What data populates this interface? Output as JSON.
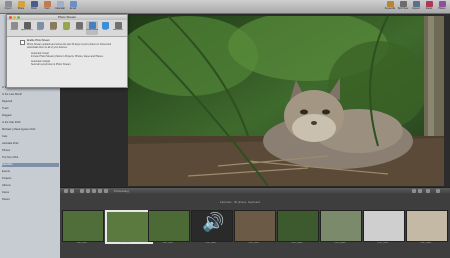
{
  "toolbar": {
    "left_items": [
      {
        "label": "Import",
        "icon": "import-icon",
        "color": "#8a8f99"
      },
      {
        "label": "Share",
        "icon": "share-icon",
        "color": "#d9a13a"
      },
      {
        "label": "Book",
        "icon": "book-icon",
        "color": "#4a5b8c"
      },
      {
        "label": "Card",
        "icon": "card-icon",
        "color": "#c47a4b"
      },
      {
        "label": "Calendar",
        "icon": "calendar-icon",
        "color": "#9fb0c7"
      },
      {
        "label": "Email",
        "icon": "email-icon",
        "color": "#6a8fc9"
      }
    ],
    "right_items": [
      {
        "label": "Keywords",
        "icon": "keywords-icon",
        "color": "#b7862f"
      },
      {
        "label": "Split View",
        "icon": "split-view-icon",
        "color": "#6c6c6c"
      },
      {
        "label": "Inspect",
        "icon": "inspect-icon",
        "color": "#5c6f8f"
      },
      {
        "label": "Faces",
        "icon": "faces-icon",
        "color": "#b3365a"
      },
      {
        "label": "Places",
        "icon": "places-icon",
        "color": "#8f4ea0"
      }
    ]
  },
  "sidebar": {
    "items": [
      {
        "label": "In the Last Week",
        "selected": false
      },
      {
        "label": "In the Last Month",
        "selected": false
      },
      {
        "label": "Rejected",
        "selected": false
      },
      {
        "label": "Trash",
        "selected": false
      },
      {
        "label": "Flagged",
        "selected": false
      },
      {
        "label": "In the Oak 2012",
        "selected": false
      },
      {
        "label": "Michael y Maria Agosto 2012",
        "selected": false
      },
      {
        "label": "Cats",
        "selected": false
      },
      {
        "label": "Australia 2012",
        "selected": false
      },
      {
        "label": "Photos",
        "selected": false
      },
      {
        "label": "Trip Nov 2012",
        "selected": false
      },
      {
        "label": "Favorites",
        "selected": true
      },
      {
        "label": "Events",
        "selected": false
      },
      {
        "label": "Projects",
        "selected": false
      },
      {
        "label": "Albums",
        "selected": false
      },
      {
        "label": "Faces",
        "selected": false
      },
      {
        "label": "Places",
        "selected": false
      }
    ]
  },
  "prefs": {
    "title": "Photo Stream",
    "tabs": [
      {
        "label": "General",
        "icon": "general-icon",
        "color": "#8c8c8c"
      },
      {
        "label": "Appearance",
        "icon": "appearance-icon",
        "color": "#5e5e5e"
      },
      {
        "label": "Import",
        "icon": "import-icon",
        "color": "#7d8fa6"
      },
      {
        "label": "Export",
        "icon": "export-icon",
        "color": "#8a7a5c"
      },
      {
        "label": "Labels",
        "icon": "labels-icon",
        "color": "#9aa64f"
      },
      {
        "label": "Previews",
        "icon": "previews-icon",
        "color": "#6f6f6f"
      },
      {
        "label": "Photo Stream",
        "icon": "photo-stream-icon",
        "color": "#4a7fbf",
        "selected": true
      },
      {
        "label": "Web",
        "icon": "web-icon",
        "color": "#3b8fd9"
      },
      {
        "label": "Advanced",
        "icon": "advanced-icon",
        "color": "#707070"
      }
    ],
    "enable_label": "Enable Photo Stream",
    "description": "Photo Stream uploads and stores the last 30 days of your photos on iCloud and downloads them to all of your devices.",
    "auto_import_label": "Automatic Import",
    "auto_import_desc": "Include Photo Stream photos in Projects, Photos, Faces and Places.",
    "auto_upload_label": "Automatic Upload",
    "auto_upload_desc": "Send all new photos to Photo Stream."
  },
  "controls": {
    "processing_label": "Processing"
  },
  "filmstrip": {
    "caption": "Favorites · 30 photos, Keyboard",
    "thumbnails": [
      {
        "label": "DSC_8011",
        "color": "#4f6e3a",
        "selected": false
      },
      {
        "label": "DSC_8016",
        "color": "#5a7a3f",
        "selected": true
      },
      {
        "label": "DSC_8021",
        "color": "#4c6a35",
        "selected": false
      },
      {
        "label": "DSC_8031",
        "color": "#2a2a2a",
        "selected": false
      },
      {
        "label": "DSC_8037",
        "color": "#6b5a45",
        "selected": false
      },
      {
        "label": "DSC_8040",
        "color": "#3d5a2e",
        "selected": false
      },
      {
        "label": "DSC_8046",
        "color": "#7a8a6a",
        "selected": false
      },
      {
        "label": "DSC_8051",
        "color": "#cfcfcf",
        "selected": false
      },
      {
        "label": "DSC_8061",
        "color": "#c4b9a5",
        "selected": false
      }
    ]
  }
}
